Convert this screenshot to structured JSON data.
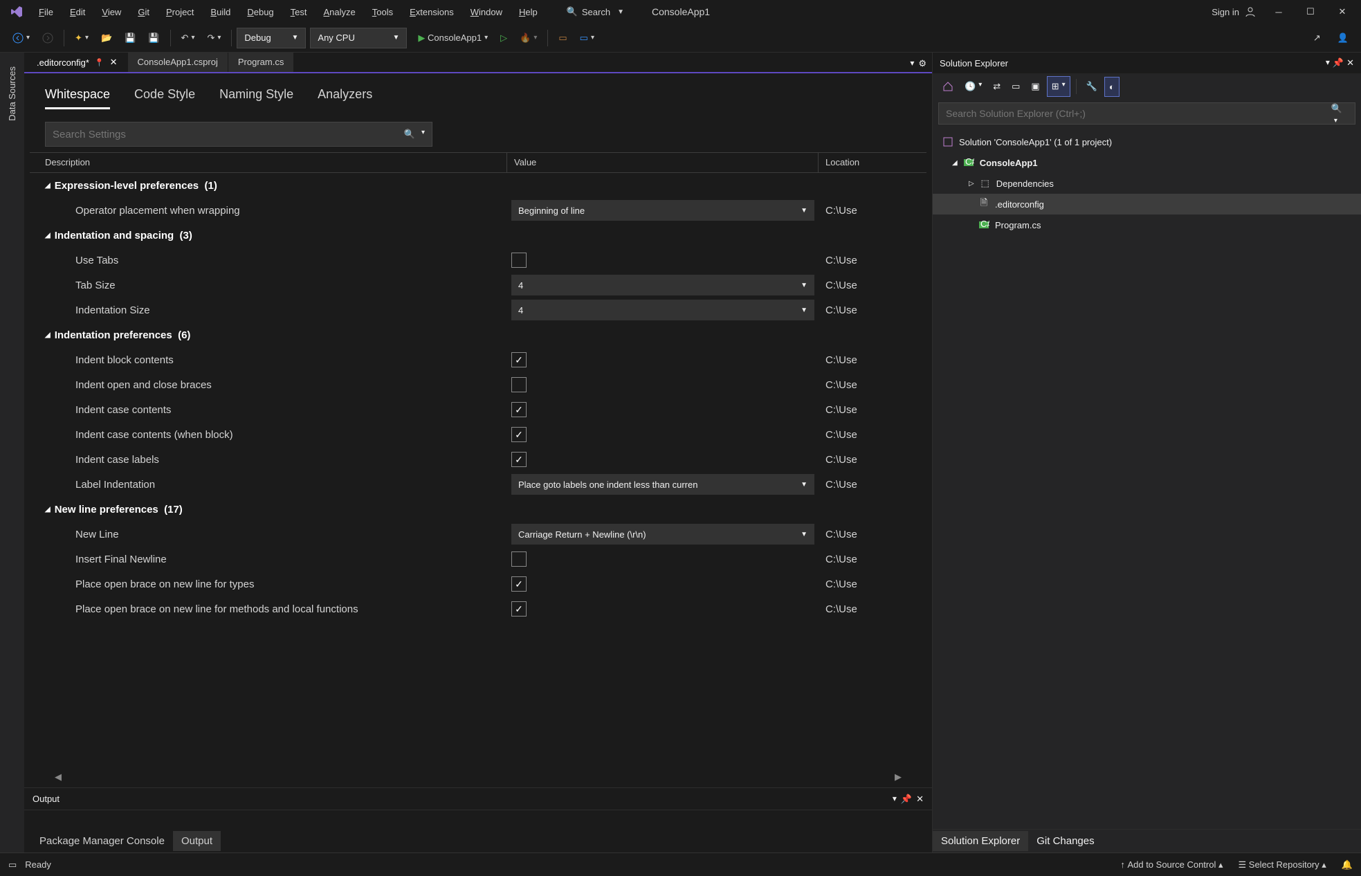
{
  "title_bar": {
    "menu": [
      "File",
      "Edit",
      "View",
      "Git",
      "Project",
      "Build",
      "Debug",
      "Test",
      "Analyze",
      "Tools",
      "Extensions",
      "Window",
      "Help"
    ],
    "search_label": "Search",
    "app_name": "ConsoleApp1",
    "sign_in": "Sign in"
  },
  "toolbar": {
    "config": "Debug",
    "platform": "Any CPU",
    "run_target": "ConsoleApp1"
  },
  "left_rail": {
    "label": "Data Sources"
  },
  "tabs": {
    "items": [
      {
        "label": ".editorconfig*",
        "active": true,
        "pinned": true
      },
      {
        "label": "ConsoleApp1.csproj",
        "active": false
      },
      {
        "label": "Program.cs",
        "active": false
      }
    ]
  },
  "editor": {
    "style_tabs": [
      "Whitespace",
      "Code Style",
      "Naming Style",
      "Analyzers"
    ],
    "active_tab": "Whitespace",
    "search_placeholder": "Search Settings",
    "columns": {
      "description": "Description",
      "value": "Value",
      "location": "Location"
    },
    "groups": [
      {
        "name": "Expression-level preferences",
        "count": "(1)",
        "rows": [
          {
            "d": "Operator placement when wrapping",
            "type": "dd",
            "v": "Beginning of line",
            "l": "C:\\Use"
          }
        ]
      },
      {
        "name": "Indentation and spacing",
        "count": "(3)",
        "rows": [
          {
            "d": "Use Tabs",
            "type": "cb",
            "v": false,
            "l": "C:\\Use"
          },
          {
            "d": "Tab Size",
            "type": "dd",
            "v": "4",
            "l": "C:\\Use"
          },
          {
            "d": "Indentation Size",
            "type": "dd",
            "v": "4",
            "l": "C:\\Use"
          }
        ]
      },
      {
        "name": "Indentation preferences",
        "count": "(6)",
        "rows": [
          {
            "d": "Indent block contents",
            "type": "cb",
            "v": true,
            "l": "C:\\Use"
          },
          {
            "d": "Indent open and close braces",
            "type": "cb",
            "v": false,
            "l": "C:\\Use"
          },
          {
            "d": "Indent case contents",
            "type": "cb",
            "v": true,
            "l": "C:\\Use"
          },
          {
            "d": "Indent case contents (when block)",
            "type": "cb",
            "v": true,
            "l": "C:\\Use"
          },
          {
            "d": "Indent case labels",
            "type": "cb",
            "v": true,
            "l": "C:\\Use"
          },
          {
            "d": "Label Indentation",
            "type": "dd",
            "v": "Place goto labels one indent less than curren",
            "l": "C:\\Use"
          }
        ]
      },
      {
        "name": "New line preferences",
        "count": "(17)",
        "rows": [
          {
            "d": "New Line",
            "type": "dd",
            "v": "Carriage Return + Newline (\\r\\n)",
            "l": "C:\\Use"
          },
          {
            "d": "Insert Final Newline",
            "type": "cb",
            "v": false,
            "l": "C:\\Use"
          },
          {
            "d": "Place open brace on new line for types",
            "type": "cb",
            "v": true,
            "l": "C:\\Use"
          },
          {
            "d": "Place open brace on new line for methods and local functions",
            "type": "cb",
            "v": true,
            "l": "C:\\Use"
          }
        ]
      }
    ]
  },
  "output": {
    "title": "Output",
    "bottom_tabs": [
      "Package Manager Console",
      "Output"
    ],
    "active": "Output"
  },
  "solution_explorer": {
    "title": "Solution Explorer",
    "search_placeholder": "Search Solution Explorer (Ctrl+;)",
    "root": "Solution 'ConsoleApp1' (1 of 1 project)",
    "project": "ConsoleApp1",
    "deps": "Dependencies",
    "files": [
      ".editorconfig",
      "Program.cs"
    ],
    "bottom_tabs": [
      "Solution Explorer",
      "Git Changes"
    ]
  },
  "status_bar": {
    "ready": "Ready",
    "source_control": "Add to Source Control",
    "repo": "Select Repository"
  }
}
